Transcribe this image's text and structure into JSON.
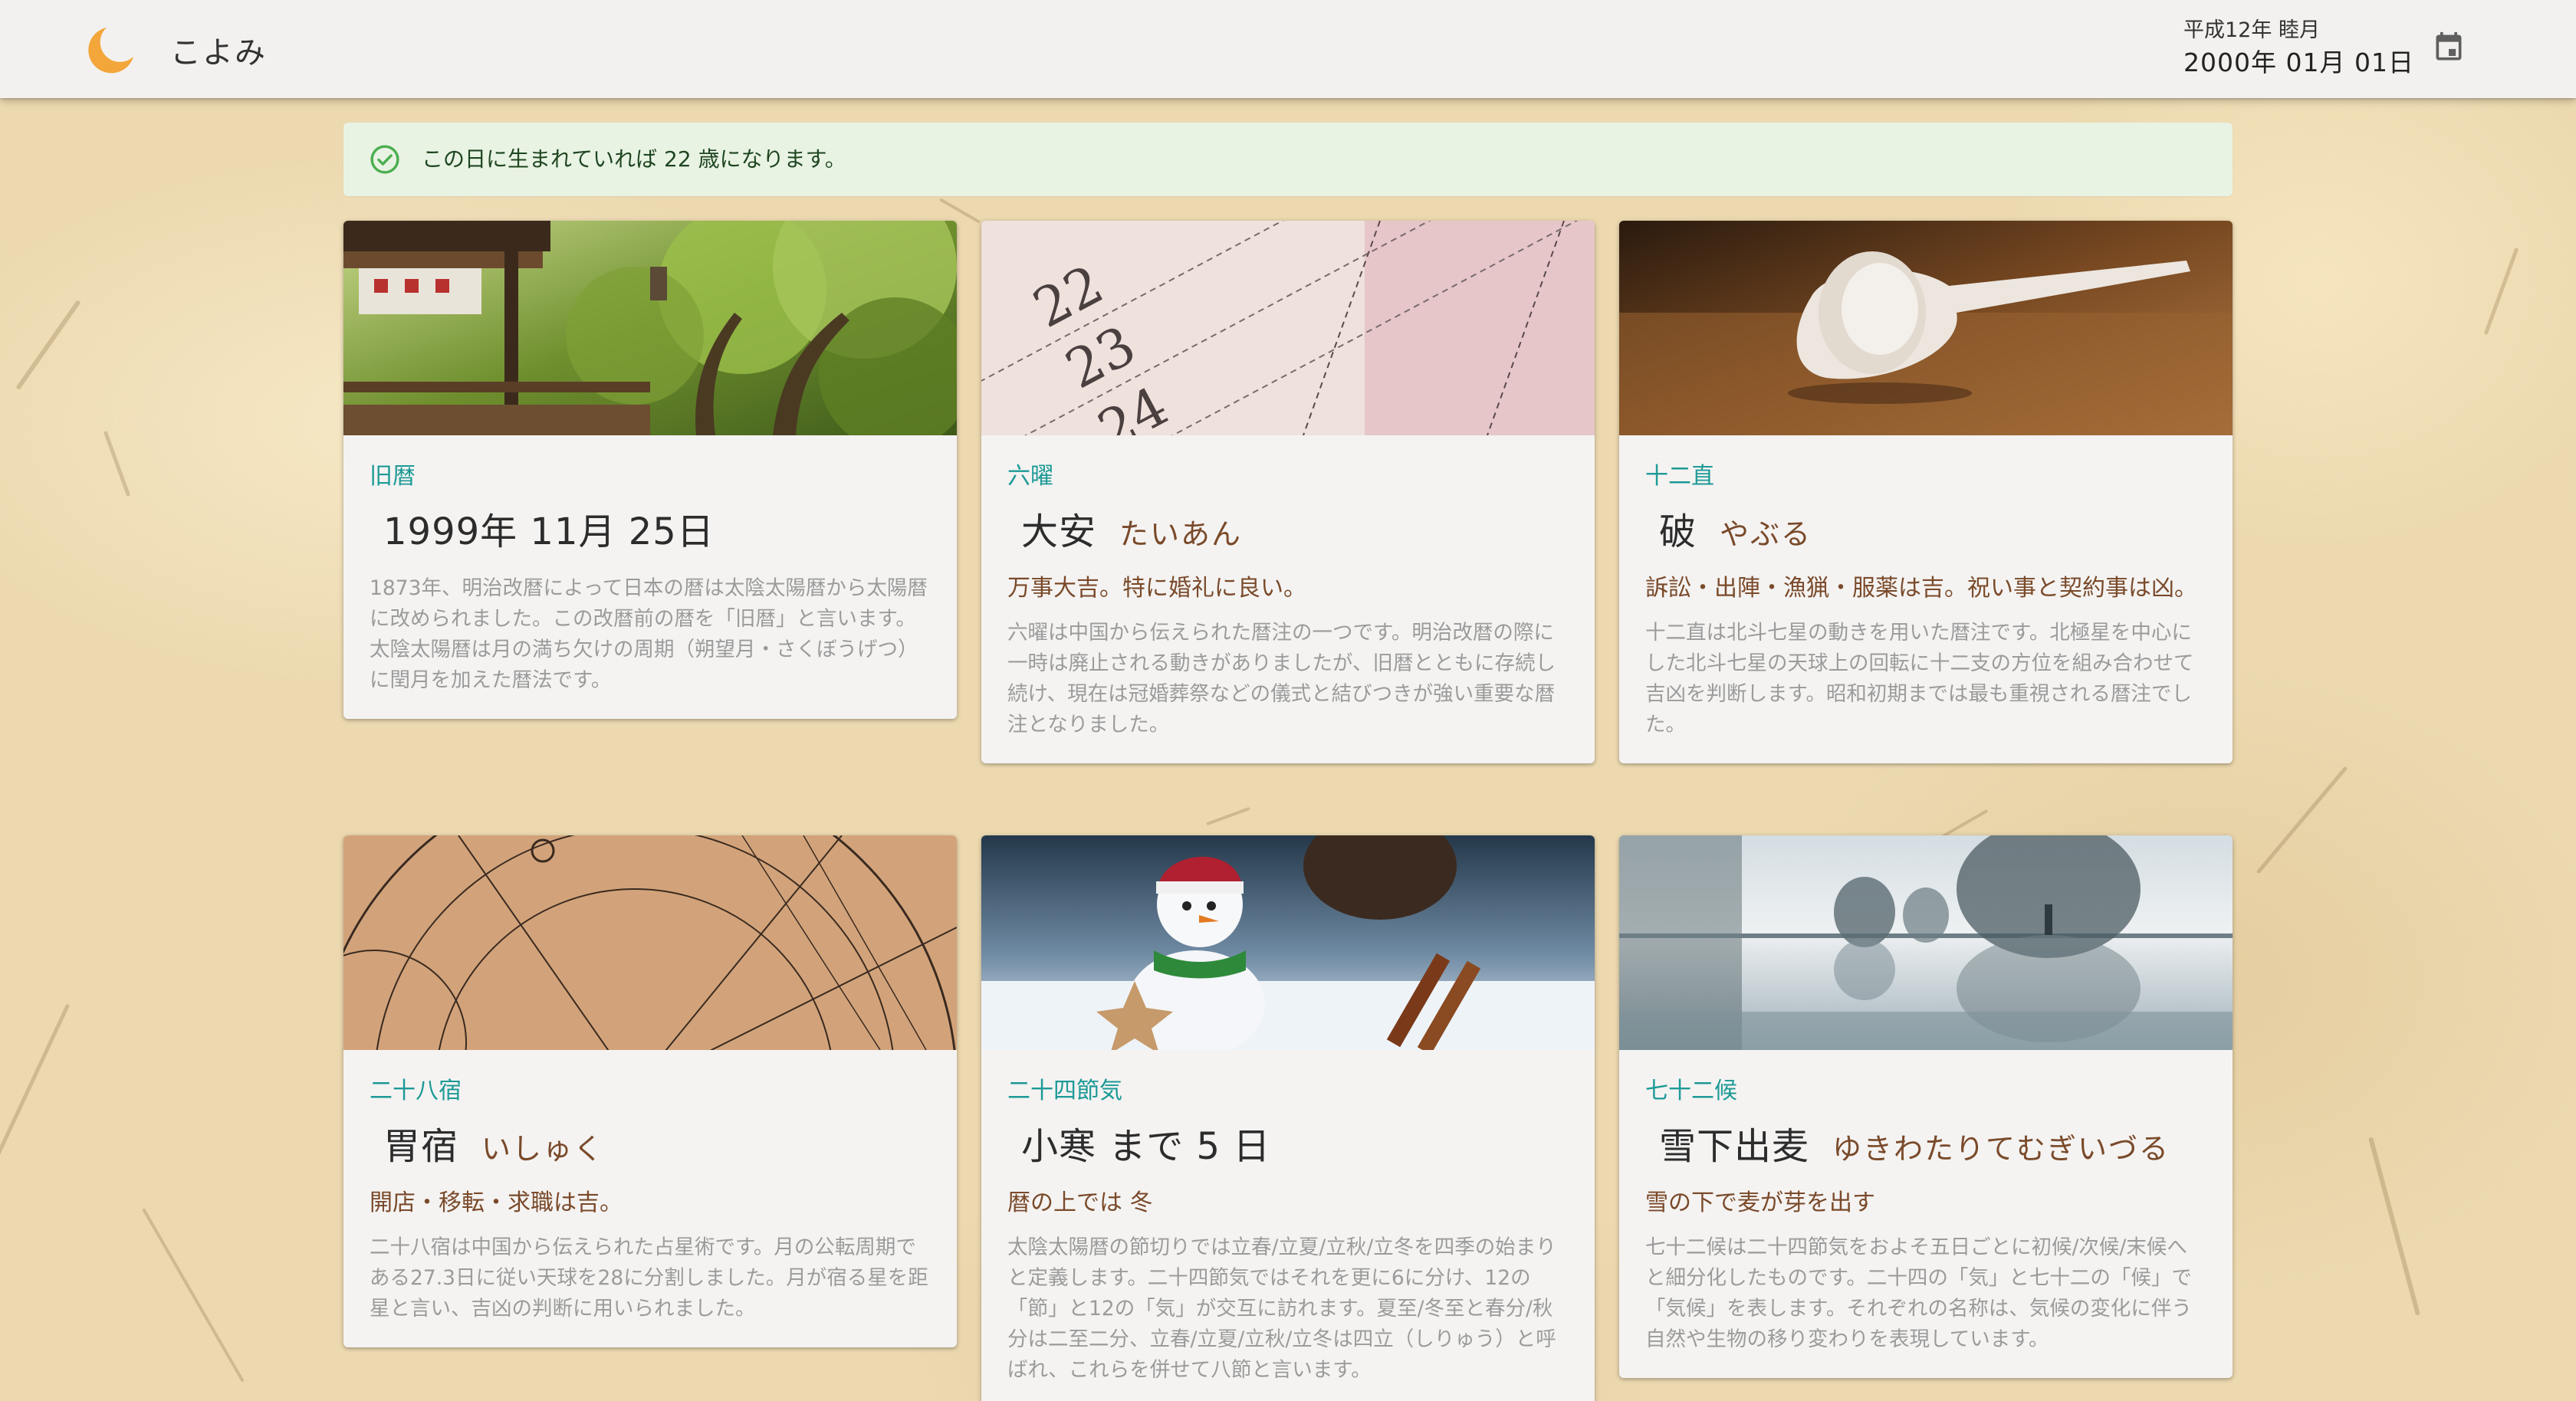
{
  "app": {
    "title": "こよみ"
  },
  "date": {
    "wareki": "平成12年 睦月",
    "seireki": "2000年 01月 01日"
  },
  "alert": {
    "message": "この日に生まれていれば 22 歳になります。"
  },
  "cards": [
    {
      "image": "shrine-forest-photo",
      "category": "旧暦",
      "title": "1999年 11月 25日",
      "reading": "",
      "summary": "",
      "description": "1873年、明治改暦によって日本の暦は太陰太陽暦から太陽暦に改められました。この改暦前の暦を「旧暦」と言います。太陰太陽暦は月の満ち欠けの周期（朔望月・さくぼうげつ）に閏月を加えた暦法です。"
    },
    {
      "image": "calendar-rokuyo-photo",
      "category": "六曜",
      "title": "大安",
      "reading": "たいあん",
      "summary": "万事大吉。特に婚礼に良い。",
      "description": "六曜は中国から伝えられた暦注の一つです。明治改暦の際に一時は廃止される動きがありましたが、旧暦とともに存続し続け、現在は冠婚葬祭などの儀式と結びつきが強い重要な暦注となりました。"
    },
    {
      "image": "white-pipe-photo",
      "category": "十二直",
      "title": "破",
      "reading": "やぶる",
      "summary": "訴訟・出陣・漁猟・服薬は吉。祝い事と契約事は凶。",
      "description": "十二直は北斗七星の動きを用いた暦注です。北極星を中心にした北斗七星の天球上の回転に十二支の方位を組み合わせて吉凶を判断します。昭和初期までは最も重視される暦注でした。"
    },
    {
      "image": "astrology-chart-photo",
      "category": "二十八宿",
      "title": "胃宿",
      "reading": "いしゅく",
      "summary": "開店・移転・求職は吉。",
      "description": "二十八宿は中国から伝えられた占星術です。月の公転周期である27.3日に従い天球を28に分割しました。月が宿る星を距星と言い、吉凶の判断に用いられました。"
    },
    {
      "image": "snowman-photo",
      "category": "二十四節気",
      "title": "小寒 まで 5 日",
      "reading": "",
      "summary": "暦の上では 冬",
      "description": "太陰太陽暦の節切りでは立春/立夏/立秋/立冬を四季の始まりと定義します。二十四節気ではそれを更に6に分け、12の「節」と12の「気」が交互に訪れます。夏至/冬至と春分/秋分は二至二分、立春/立夏/立秋/立冬は四立（しりゅう）と呼ばれ、これらを併せて八節と言います。"
    },
    {
      "image": "frosty-lake-photo",
      "category": "七十二候",
      "title": "雪下出麦",
      "reading": "ゆきわたりてむぎいづる",
      "summary": "雪の下で麦が芽を出す",
      "description": "七十二候は二十四節気をおよそ五日ごとに初候/次候/末候へと細分化したものです。二十四の「気」と七十二の「候」で「気候」を表します。それぞれの名称は、気候の変化に伴う自然や生物の移り変わりを表現しています。"
    }
  ]
}
